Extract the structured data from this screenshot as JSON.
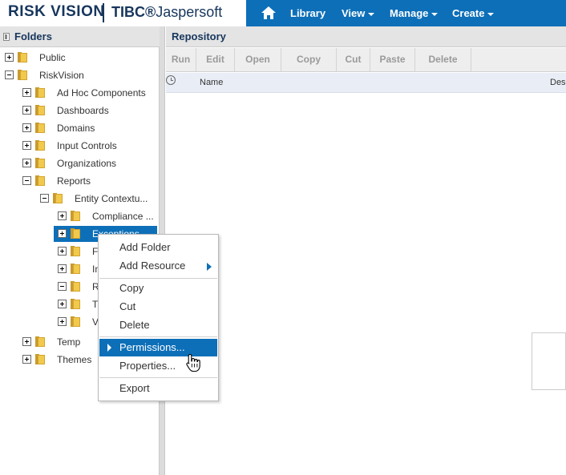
{
  "brand": {
    "product": "RISK VISION",
    "vendor_bold": "TIBC",
    "vendor_symbol": "®",
    "vendor_light": "Jaspersoft"
  },
  "nav": {
    "home_icon": "home-icon",
    "items": [
      {
        "label": "Library",
        "has_caret": false
      },
      {
        "label": "View",
        "has_caret": true
      },
      {
        "label": "Manage",
        "has_caret": true
      },
      {
        "label": "Create",
        "has_caret": true
      }
    ]
  },
  "folders_panel": {
    "title": "Folders",
    "tree": [
      {
        "label": "Public",
        "toggle": "plus"
      },
      {
        "label": "RiskVision",
        "toggle": "minus"
      },
      {
        "label": "Ad Hoc Components",
        "toggle": "plus"
      },
      {
        "label": "Dashboards",
        "toggle": "plus"
      },
      {
        "label": "Domains",
        "toggle": "plus"
      },
      {
        "label": "Input Controls",
        "toggle": "plus"
      },
      {
        "label": "Organizations",
        "toggle": "plus"
      },
      {
        "label": "Reports",
        "toggle": "minus"
      },
      {
        "label": "Entity Contextu...",
        "toggle": "minus"
      },
      {
        "label": "Compliance ...",
        "toggle": "plus"
      },
      {
        "label": "Exceptions",
        "toggle": "plus",
        "selected": true
      },
      {
        "label": "Fi",
        "toggle": "plus"
      },
      {
        "label": "In",
        "toggle": "plus"
      },
      {
        "label": "R",
        "toggle": "minus"
      },
      {
        "label": "T",
        "toggle": "plus"
      },
      {
        "label": "V",
        "toggle": "plus"
      },
      {
        "label": "Temp",
        "toggle": "plus"
      },
      {
        "label": "Themes",
        "toggle": "plus"
      }
    ]
  },
  "repository_panel": {
    "title": "Repository",
    "toolbar": [
      "Run",
      "Edit",
      "Open",
      "Copy",
      "Cut",
      "Paste",
      "Delete"
    ],
    "columns": {
      "recent_icon": "clock-icon",
      "name": "Name",
      "description": "Des"
    }
  },
  "context_menu": {
    "items": [
      {
        "label": "Add Folder"
      },
      {
        "label": "Add Resource",
        "submenu": true
      },
      {
        "label": "Copy"
      },
      {
        "label": "Cut"
      },
      {
        "label": "Delete"
      },
      {
        "label": "Permissions...",
        "highlighted": true
      },
      {
        "label": "Properties..."
      },
      {
        "label": "Export"
      }
    ]
  },
  "colors": {
    "header_blue": "#0d6fb8",
    "brand_navy": "#17365d",
    "selection_blue": "#0d6fb8",
    "folder_yellow": "#f1c94d"
  }
}
